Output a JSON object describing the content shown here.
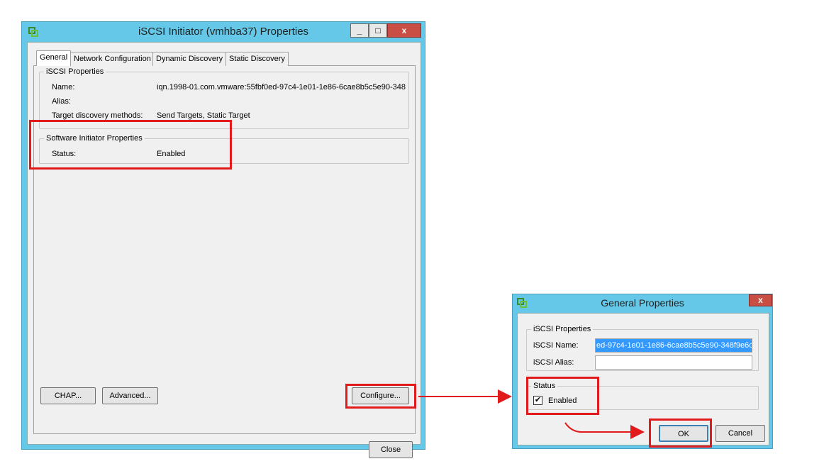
{
  "main_window": {
    "title": "iSCSI Initiator (vmhba37) Properties",
    "controls": {
      "minimize": "_",
      "maximize": "□",
      "close": "x"
    },
    "tabs": [
      "General",
      "Network Configuration",
      "Dynamic Discovery",
      "Static Discovery"
    ],
    "iscsi_properties": {
      "legend": "iSCSI Properties",
      "name_label": "Name:",
      "name_value": "iqn.1998-01.com.vmware:55fbf0ed-97c4-1e01-1e86-6cae8b5c5e90-348",
      "alias_label": "Alias:",
      "alias_value": "",
      "discovery_label": "Target discovery methods:",
      "discovery_value": "Send Targets, Static Target"
    },
    "software_initiator": {
      "legend": "Software Initiator Properties",
      "status_label": "Status:",
      "status_value": "Enabled"
    },
    "buttons": {
      "chap": "CHAP...",
      "advanced": "Advanced...",
      "configure": "Configure...",
      "close": "Close"
    }
  },
  "dialog": {
    "title": "General Properties",
    "close": "x",
    "iscsi_properties": {
      "legend": "iSCSI Properties",
      "name_label": "iSCSI Name:",
      "name_value": "ed-97c4-1e01-1e86-6cae8b5c5e90-348f9e6c",
      "alias_label": "iSCSI Alias:",
      "alias_value": ""
    },
    "status": {
      "legend": "Status",
      "enabled_label": "Enabled",
      "enabled_checked": true
    },
    "buttons": {
      "ok": "OK",
      "cancel": "Cancel"
    }
  },
  "colors": {
    "titlebar": "#65c8e8",
    "highlight": "#e11b1b",
    "selection": "#3399ff",
    "close_button": "#c94f44"
  }
}
